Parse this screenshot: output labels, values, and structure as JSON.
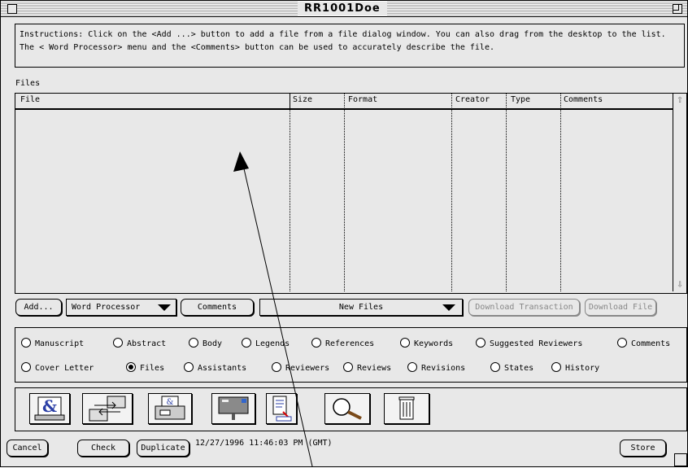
{
  "window": {
    "title": "RR1001Doe"
  },
  "instructions": "Instructions: Click on the <Add ...> button to add a file from a file dialog window.  You can also drag from the desktop to the list.  The < Word Processor> menu and the <Comments> button can be used to accurately describe the file.",
  "files": {
    "label": "Files",
    "columns": [
      "File",
      "Size",
      "Format",
      "Creator",
      "Type",
      "Comments"
    ],
    "rows": []
  },
  "toolbar": {
    "add": "Add...",
    "word_processor": "Word Processor",
    "comments": "Comments",
    "new_files": "New Files",
    "download_transaction": "Download Transaction",
    "download_file": "Download File"
  },
  "radios": {
    "row1": [
      "Manuscript",
      "Abstract",
      "Body",
      "Legends",
      "References",
      "Keywords",
      "Suggested Reviewers",
      "Comments"
    ],
    "row2": [
      "Cover Letter",
      "Files",
      "Assistants",
      "Reviewers",
      "Reviews",
      "Revisions",
      "States",
      "History"
    ],
    "selected": "Files"
  },
  "icons": [
    "word-processor-icon",
    "transfer-icon",
    "printer-icon",
    "mailbox-icon",
    "document-icon",
    "search-icon",
    "trash-icon"
  ],
  "bottom": {
    "cancel": "Cancel",
    "check": "Check",
    "duplicate": "Duplicate",
    "timestamp": "12/27/1996 11:46:03 PM (GMT)",
    "store": "Store"
  }
}
